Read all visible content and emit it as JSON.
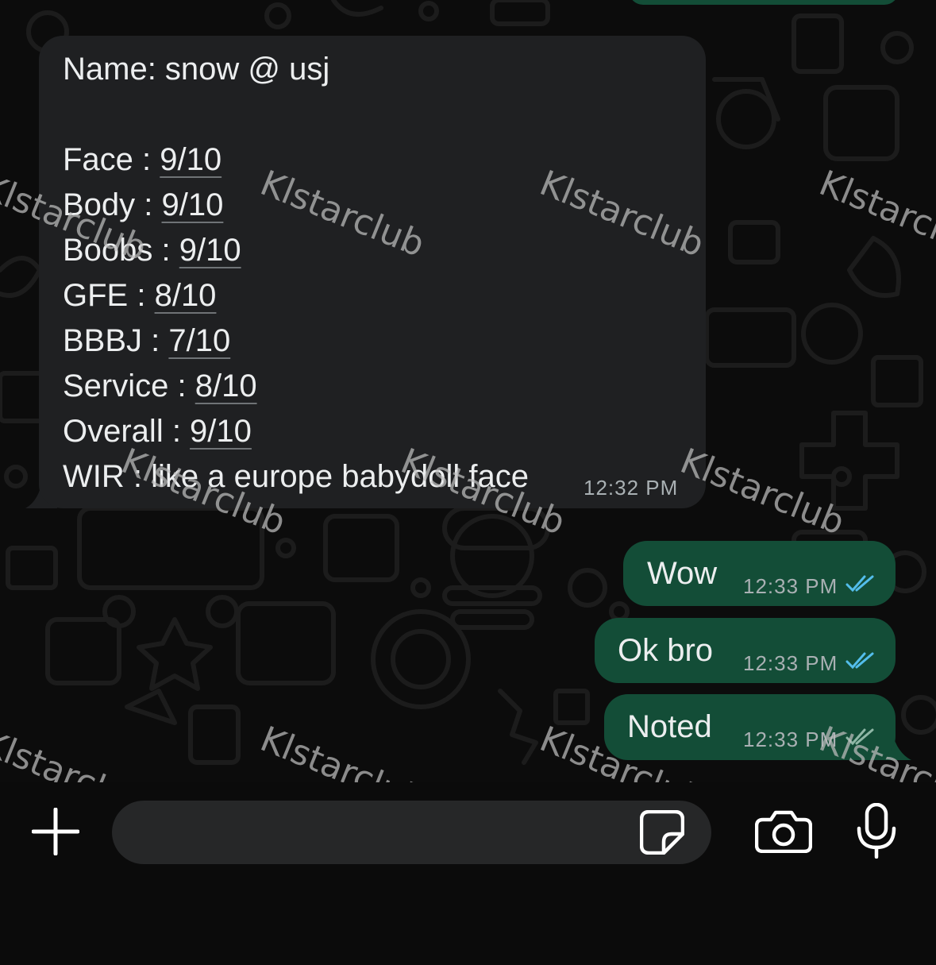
{
  "incoming_message": {
    "lines": [
      {
        "label": "Name: snow @ usj",
        "value": ""
      },
      {
        "label": "",
        "value": ""
      },
      {
        "label": "Face : ",
        "value": "9/10"
      },
      {
        "label": "Body : ",
        "value": "9/10"
      },
      {
        "label": "Boobs : ",
        "value": "9/10"
      },
      {
        "label": "GFE : ",
        "value": "8/10"
      },
      {
        "label": "BBBJ : ",
        "value": "7/10"
      },
      {
        "label": "Service : ",
        "value": "8/10"
      },
      {
        "label": "Overall : ",
        "value": "9/10"
      },
      {
        "label": "WIR : like a europe babydoll face",
        "value": ""
      }
    ],
    "time": "12:32 PM"
  },
  "outgoing_messages": [
    {
      "text": "Wow",
      "time": "12:33 PM"
    },
    {
      "text": "Ok bro",
      "time": "12:33 PM"
    },
    {
      "text": "Noted",
      "time": "12:33 PM"
    }
  ],
  "watermark": "Klstarclub",
  "composer": {
    "placeholder": "",
    "add_icon": "plus-icon",
    "sticker_icon": "sticker-icon",
    "camera_icon": "camera-icon",
    "mic_icon": "microphone-icon"
  },
  "colors": {
    "incoming_bubble": "#1f2022",
    "outgoing_bubble": "#134d37",
    "read_ticks": "#53bdeb"
  }
}
